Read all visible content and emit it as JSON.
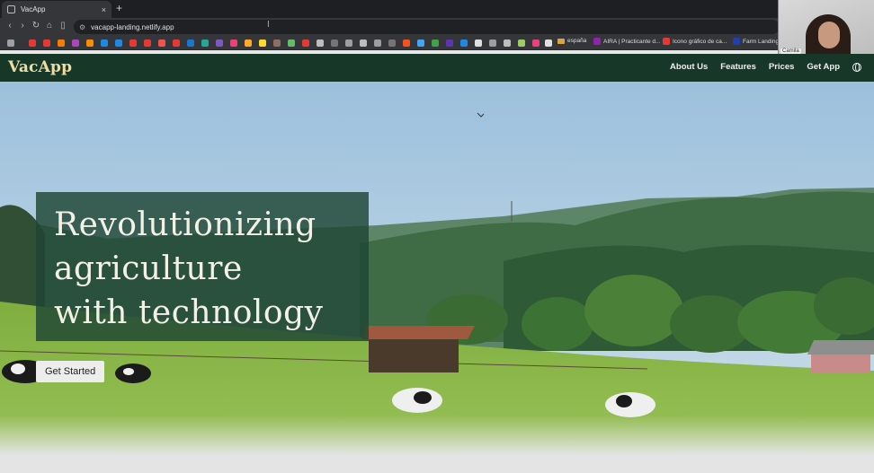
{
  "browser": {
    "tab_title": "VacApp",
    "tab_close": "×",
    "new_tab": "+",
    "url": "vacapp-landing.netlify.app",
    "bookmarks": [
      {
        "label": "españa"
      },
      {
        "label": "AIRA | Practicante d..."
      },
      {
        "label": "Icono gráfico de ca..."
      },
      {
        "label": "Farm Landing"
      }
    ]
  },
  "webcam": {
    "name": "Camila"
  },
  "site": {
    "logo": "VacApp",
    "nav": [
      "About Us",
      "Features",
      "Prices",
      "Get App"
    ]
  },
  "hero": {
    "title_lines": [
      "Revolutionizing",
      "agriculture",
      "with technology"
    ],
    "cta": "Get Started"
  },
  "colors": {
    "nav_bg": "#173828",
    "logo": "#ecdca5",
    "card": "#1e4634"
  }
}
